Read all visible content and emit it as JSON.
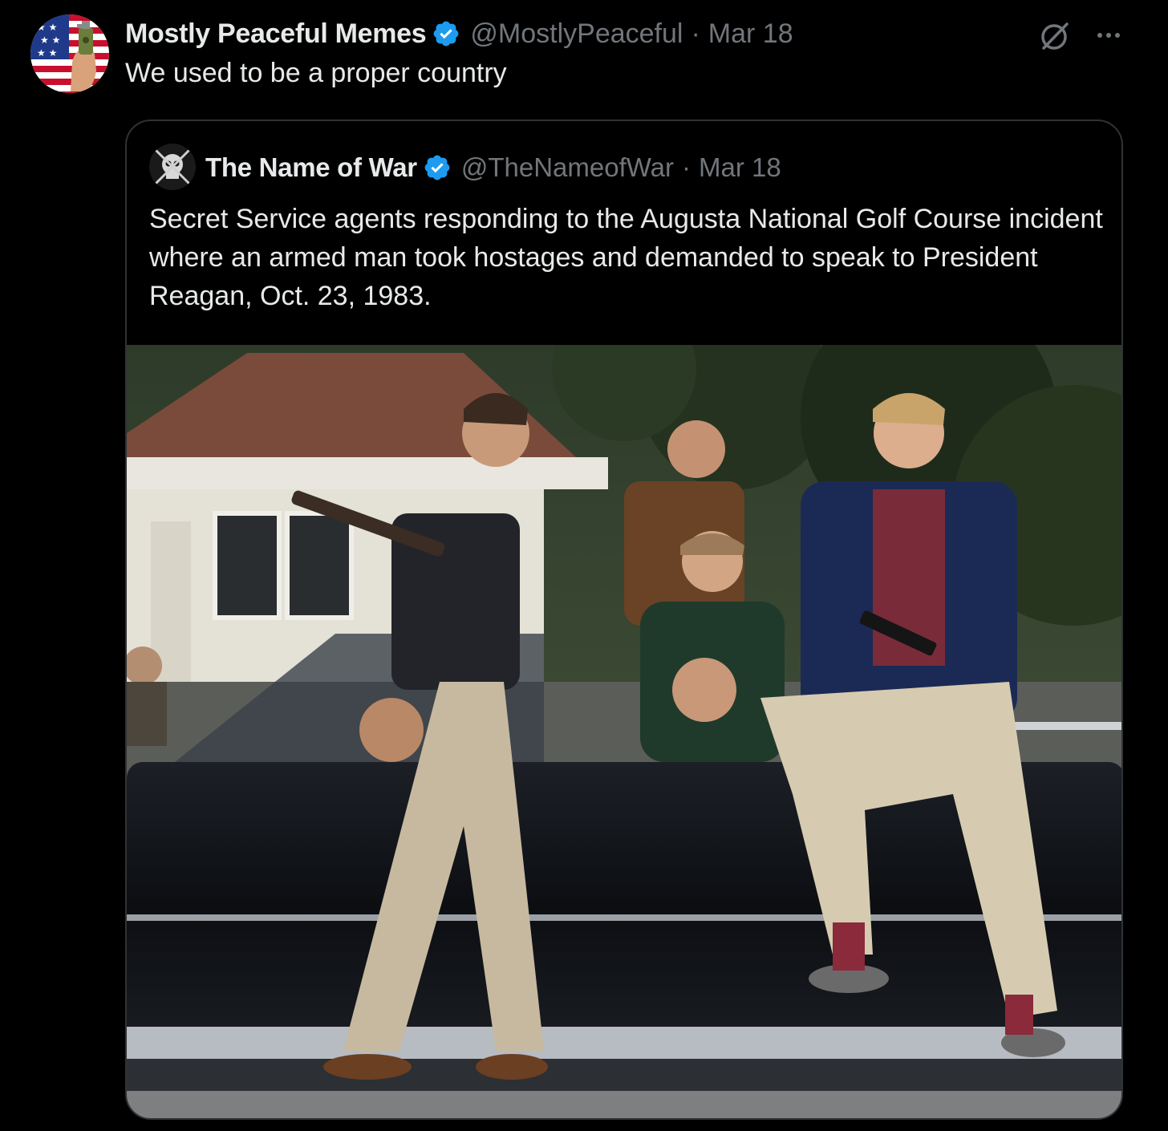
{
  "post": {
    "author_name": "Mostly Peaceful Memes",
    "handle": "@MostlyPeaceful",
    "separator": "·",
    "date": "Mar 18",
    "text": "We used to be a proper country",
    "avatar_icon": "flag-hand-avatar",
    "verified_icon": "verified-badge-icon",
    "actions": {
      "grok_icon": "grok-icon",
      "more_icon": "more-icon"
    }
  },
  "quoted_post": {
    "author_name": "The Name of War",
    "handle": "@TheNameofWar",
    "separator": "·",
    "date": "Mar 18",
    "text": "Secret Service agents responding to the Augusta National Golf Course incident where an armed man took hostages and demanded to speak to President Reagan, Oct. 23, 1983.",
    "media_icon": "photo-agents-on-limousine"
  },
  "colors": {
    "background": "#000000",
    "primary_text": "#e7e9ea",
    "secondary_text": "#71767b",
    "border": "#2f3336",
    "verified": "#1d9bf0"
  }
}
